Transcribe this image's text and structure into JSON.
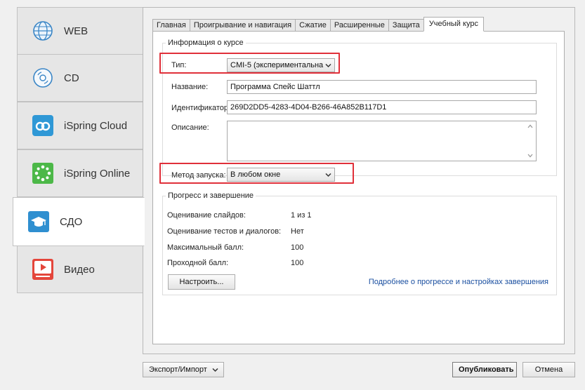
{
  "nav": {
    "items": [
      {
        "label": "WEB",
        "icon": "globe-icon"
      },
      {
        "label": "CD",
        "icon": "cd-icon"
      },
      {
        "label": "iSpring Cloud",
        "icon": "ispring-cloud-icon"
      },
      {
        "label": "iSpring Online",
        "icon": "ispring-online-icon"
      },
      {
        "label": "СДО",
        "icon": "lms-graduation-cap-icon",
        "active": true
      },
      {
        "label": "Видео",
        "icon": "video-play-icon"
      }
    ]
  },
  "tabs": [
    {
      "label": "Главная"
    },
    {
      "label": "Проигрывание и навигация"
    },
    {
      "label": "Сжатие"
    },
    {
      "label": "Расширенные"
    },
    {
      "label": "Защита"
    },
    {
      "label": "Учебный курс",
      "active": true
    }
  ],
  "course_info": {
    "legend": "Информация о курсе",
    "type_label": "Тип:",
    "type_value": "CMI-5 (экспериментальна",
    "name_label": "Название:",
    "name_value": "Программа Спейс Шаттл",
    "id_label": "Идентификатор:",
    "id_value": "269D2DD5-4283-4D04-B266-46A852B117D1",
    "description_label": "Описание:",
    "description_value": "",
    "launch_label": "Метод запуска:",
    "launch_value": "В любом окне"
  },
  "progress": {
    "legend": "Прогресс и завершение",
    "rows": [
      {
        "label": "Оценивание слайдов:",
        "value": "1 из 1"
      },
      {
        "label": "Оценивание тестов и диалогов:",
        "value": "Нет"
      },
      {
        "label": "Максимальный балл:",
        "value": "100"
      },
      {
        "label": "Проходной балл:",
        "value": "100"
      }
    ],
    "configure_button": "Настроить...",
    "more_link": "Подробнее о прогрессе и настройках завершения"
  },
  "footer": {
    "export_import": "Экспорт/Импорт",
    "publish": "Опубликовать",
    "cancel": "Отмена"
  },
  "colors": {
    "highlight": "#e0303a",
    "link": "#1a4fa0",
    "ispring_cloud": "#2f98d6",
    "ispring_online": "#4cb848",
    "lms": "#2f8fd0",
    "video": "#e4463b"
  }
}
